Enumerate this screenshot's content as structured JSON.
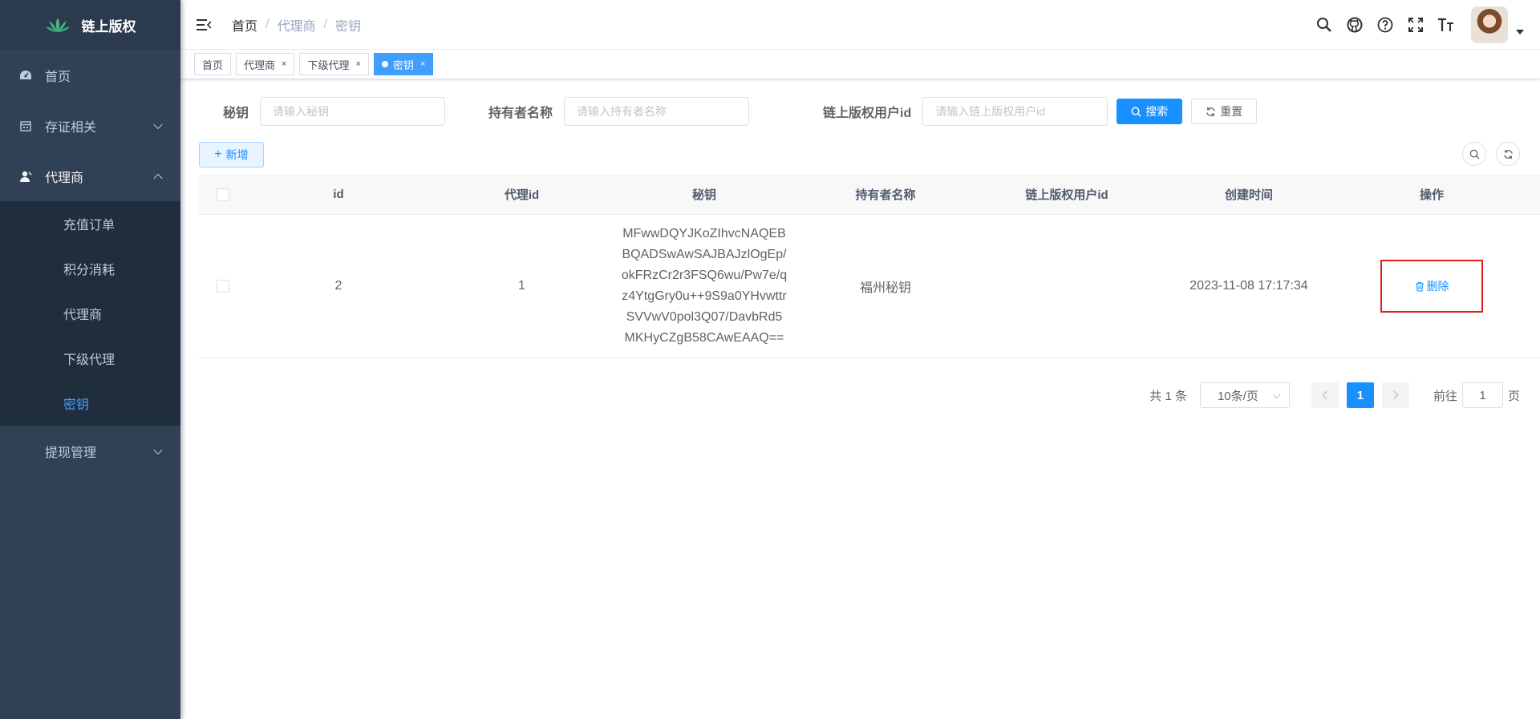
{
  "app": {
    "title": "链上版权"
  },
  "sidebar": {
    "items": [
      {
        "label": "首页",
        "icon": "dashboard-icon"
      },
      {
        "label": "存证相关",
        "icon": "calendar-icon"
      },
      {
        "label": "代理商",
        "icon": "user-icon",
        "expanded": true,
        "children": [
          {
            "label": "充值订单"
          },
          {
            "label": "积分消耗"
          },
          {
            "label": "代理商"
          },
          {
            "label": "下级代理"
          },
          {
            "label": "密钥",
            "active": true
          }
        ]
      },
      {
        "label": "提现管理",
        "icon": "none"
      }
    ]
  },
  "breadcrumb": [
    "首页",
    "代理商",
    "密钥"
  ],
  "tags": [
    {
      "label": "首页",
      "closable": false
    },
    {
      "label": "代理商",
      "closable": true
    },
    {
      "label": "下级代理",
      "closable": true
    },
    {
      "label": "密钥",
      "closable": true,
      "active": true
    }
  ],
  "search": {
    "key_label": "秘钥",
    "key_placeholder": "请输入秘钥",
    "holder_label": "持有者名称",
    "holder_placeholder": "请输入持有者名称",
    "userid_label": "链上版权用户id",
    "userid_placeholder": "请输入链上版权用户id",
    "search_button": "搜索",
    "reset_button": "重置"
  },
  "toolbar": {
    "add_button": "新增"
  },
  "table": {
    "columns": [
      "id",
      "代理id",
      "秘钥",
      "持有者名称",
      "链上版权用户id",
      "创建时间",
      "操作"
    ],
    "rows": [
      {
        "id": "2",
        "agent_id": "1",
        "key_lines": [
          "MFwwDQYJKoZIhvcNAQEB",
          "BQADSwAwSAJBAJzlOgEp/",
          "okFRzCr2r3FSQ6wu/Pw7e/q",
          "z4YtgGry0u++9S9a0YHvwttr",
          "SVVwV0pol3Q07/DavbRd5",
          "MKHyCZgB58CAwEAAQ=="
        ],
        "holder_name": "福州秘钥",
        "user_id": "",
        "created_at": "2023-11-08 17:17:34",
        "action": "删除"
      }
    ]
  },
  "pagination": {
    "total_text": "共 1 条",
    "page_size": "10条/页",
    "current_page": "1",
    "goto_prefix": "前往",
    "goto_value": "1",
    "goto_suffix": "页"
  },
  "colors": {
    "primary": "#1890ff",
    "sidebar_bg": "#304156",
    "submenu_bg": "#1f2d3d",
    "highlight": "#e02020"
  }
}
